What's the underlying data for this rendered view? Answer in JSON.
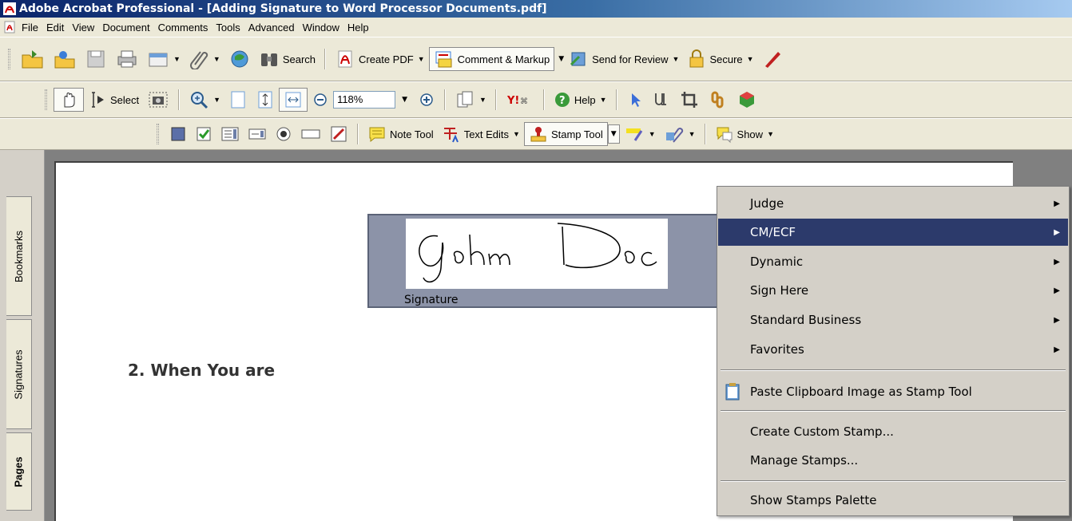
{
  "window": {
    "title": "Adobe Acrobat Professional - [Adding Signature to Word Processor Documents.pdf]"
  },
  "menubar": {
    "items": [
      "File",
      "Edit",
      "View",
      "Document",
      "Comments",
      "Tools",
      "Advanced",
      "Window",
      "Help"
    ]
  },
  "toolbar1": {
    "search_label": "Search",
    "create_pdf_label": "Create PDF",
    "comment_markup_label": "Comment & Markup",
    "send_review_label": "Send for Review",
    "secure_label": "Secure"
  },
  "toolbar2": {
    "select_label": "Select",
    "zoom_value": "118%",
    "help_label": "Help"
  },
  "toolbar3": {
    "note_tool_label": "Note Tool",
    "text_edits_label": "Text Edits",
    "stamp_tool_label": "Stamp Tool",
    "show_label": "Show"
  },
  "navtabs": {
    "bookmarks": "Bookmarks",
    "signatures": "Signatures",
    "pages": "Pages"
  },
  "document": {
    "stamp_caption": "Signature",
    "partial_text": "2.    When You are"
  },
  "stamp_menu": {
    "items": [
      {
        "label": "Judge",
        "submenu": true
      },
      {
        "label": "CM/ECF",
        "submenu": true,
        "highlighted": true
      },
      {
        "label": "Dynamic",
        "submenu": true
      },
      {
        "label": "Sign Here",
        "submenu": true
      },
      {
        "label": "Standard Business",
        "submenu": true
      },
      {
        "label": "Favorites",
        "submenu": true
      }
    ],
    "paste_label": "Paste Clipboard Image as Stamp Tool",
    "create_label": "Create Custom Stamp...",
    "manage_label": "Manage Stamps...",
    "show_palette_label": "Show Stamps Palette"
  },
  "colors": {
    "title_bar_start": "#0a246a",
    "menu_highlight": "#2c3a6b",
    "toolbar_bg": "#ece9d8"
  }
}
